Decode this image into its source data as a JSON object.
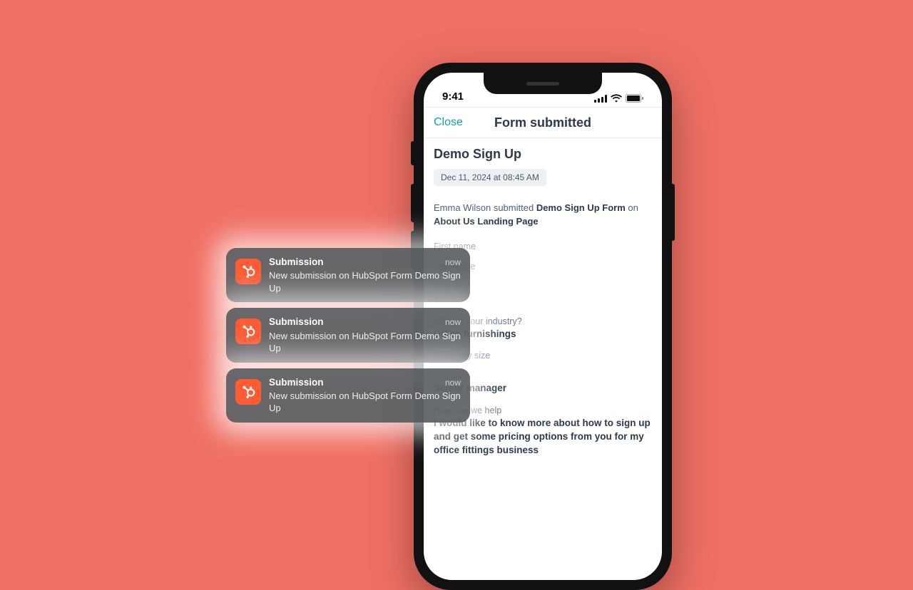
{
  "status": {
    "time": "9:41"
  },
  "nav": {
    "close": "Close",
    "title": "Form submitted"
  },
  "form": {
    "name": "Demo Sign Up",
    "timestamp": "Dec 11, 2024 at 08:45 AM",
    "submitter": "Emma Wilson",
    "submitted_verb": "submitted",
    "form_name": "Demo Sign Up Form",
    "on_word": "on",
    "page": "About Us Landing Page"
  },
  "fields": [
    {
      "label": "First name",
      "value": ""
    },
    {
      "label": "Last name",
      "value": ""
    },
    {
      "label": "Phone",
      "value": "2228"
    },
    {
      "label": "What is your industry?",
      "value": "Office furnishings"
    },
    {
      "label": "Company size",
      "value": ""
    },
    {
      "label": "Job title",
      "value": "Senior manager"
    },
    {
      "label": "How can we help",
      "value": "I would like to know more about how to sign up and get some pricing options from you for my office fittings business"
    }
  ],
  "notifications": [
    {
      "title": "Submission",
      "when": "now",
      "msg": "New submission on HubSpot Form Demo Sign Up"
    },
    {
      "title": "Submission",
      "when": "now",
      "msg": "New submission on HubSpot Form Demo Sign Up"
    },
    {
      "title": "Submission",
      "when": "now",
      "msg": "New submission on HubSpot Form Demo Sign Up"
    }
  ]
}
